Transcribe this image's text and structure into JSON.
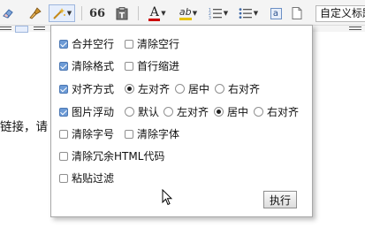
{
  "toolbar": {
    "icons": [
      "eraser-icon",
      "clear-format-brush-icon",
      "magic-wand-icon",
      "quote-icon",
      "paste-text-icon",
      "font-color-icon",
      "highlight-icon",
      "ordered-list-icon",
      "unordered-list-icon",
      "anchor-icon",
      "new-page-icon"
    ],
    "quote_glyph": "66",
    "font_color_glyph": "A",
    "font_color": "#cc0000",
    "highlight_glyph": "ab",
    "anchor_glyph": "a",
    "style_select_value": "自定义标题"
  },
  "editor": {
    "visible_text": "链接，请"
  },
  "popup": {
    "row1": {
      "merge_lines": "合并空行",
      "remove_empty_lines": "清除空行"
    },
    "row2": {
      "clear_format": "清除格式",
      "first_line_indent": "首行缩进"
    },
    "row3": {
      "alignment": "对齐方式",
      "align_left": "左对齐",
      "align_center": "居中",
      "align_right": "右对齐"
    },
    "row4": {
      "image_float": "图片浮动",
      "float_default": "默认",
      "float_left": "左对齐",
      "float_center": "居中",
      "float_right": "右对齐"
    },
    "row5": {
      "clear_font_size": "清除字号",
      "clear_font_family": "清除字体"
    },
    "row6": {
      "clear_redundant_html": "清除冗余HTML代码"
    },
    "row7": {
      "paste_filter": "粘贴过滤"
    },
    "execute_label": "执行"
  },
  "colors": {
    "checkbox_checked": "#6d9bd6",
    "popup_border": "#a8a8a8",
    "toolbar_bg": "#f4f4f4"
  }
}
